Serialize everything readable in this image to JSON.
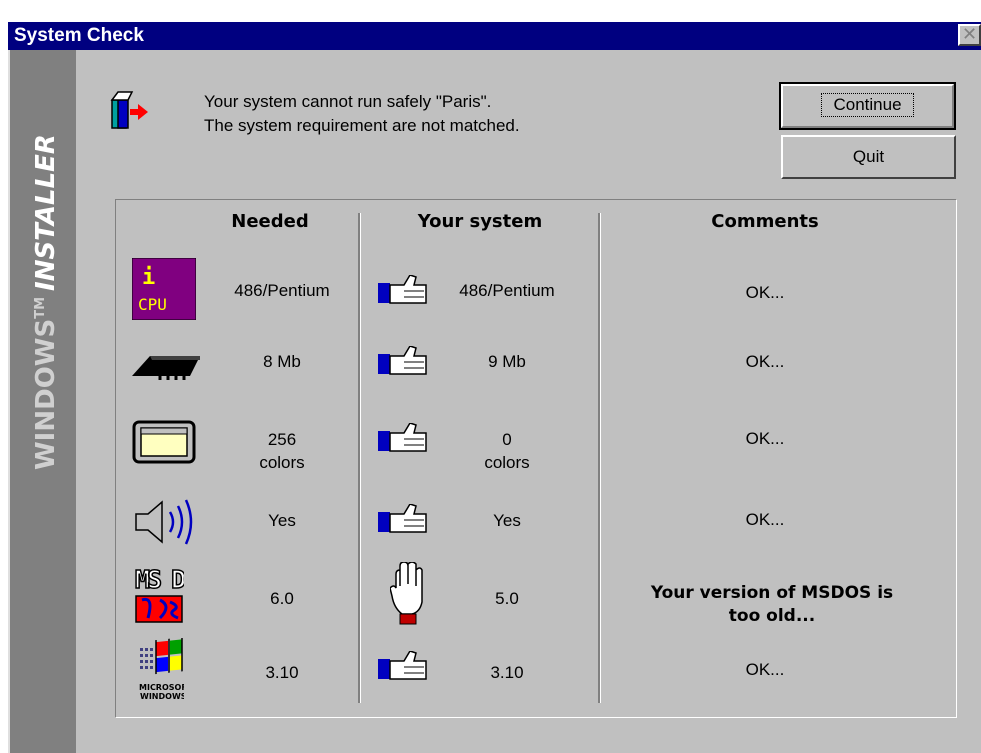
{
  "window": {
    "title": "System Check",
    "close_label": "✕"
  },
  "sidebar": {
    "brand_line1": "WINDOWS",
    "brand_tm": "TM",
    "brand_line2": "INSTALLER"
  },
  "message": {
    "line1": "Your system cannot run safely \"Paris\".",
    "line2": "The system requirement are not matched."
  },
  "buttons": {
    "continue": "Continue",
    "quit": "Quit"
  },
  "table": {
    "headers": {
      "needed": "Needed",
      "your_system": "Your system",
      "comments": "Comments"
    },
    "rows": [
      {
        "icon": "cpu-icon",
        "needed": "486/Pentium",
        "status": "thumbs-up",
        "yours": "486/Pentium",
        "comment": "OK..."
      },
      {
        "icon": "memory-chip-icon",
        "needed": "8 Mb",
        "status": "thumbs-up",
        "yours": "9 Mb",
        "comment": "OK..."
      },
      {
        "icon": "display-icon",
        "needed_l1": "256",
        "needed_l2": "colors",
        "status": "thumbs-up",
        "yours_l1": "0",
        "yours_l2": "colors",
        "comment": "OK..."
      },
      {
        "icon": "speaker-icon",
        "needed": "Yes",
        "status": "thumbs-up",
        "yours": "Yes",
        "comment": "OK..."
      },
      {
        "icon": "msdos-logo-icon",
        "needed": "6.0",
        "status": "stop-hand",
        "yours": "5.0",
        "comment_l1": "Your version of MSDOS is",
        "comment_l2": "too old..."
      },
      {
        "icon": "windows-logo-icon",
        "needed": "3.10",
        "status": "thumbs-up",
        "yours": "3.10",
        "comment": "OK..."
      }
    ]
  },
  "logo_text": {
    "msdos": "MS DOS",
    "windows_caption_1": "MICROSOFT",
    "windows_caption_2": "WINDOWS",
    "cpu_icon_top": "i",
    "cpu_icon_text": "CPU"
  }
}
